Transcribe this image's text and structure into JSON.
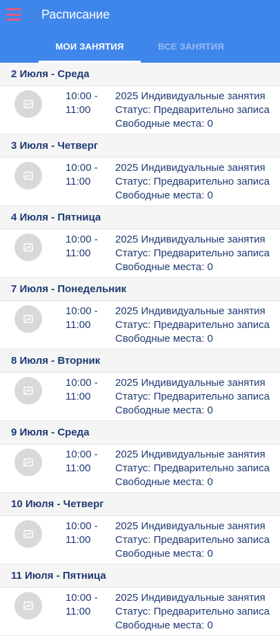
{
  "header": {
    "title": "Расписание",
    "menu_icon": "hamburger-menu-icon",
    "tabs": [
      {
        "label": "МОИ ЗАНЯТИЯ",
        "active": true
      },
      {
        "label": "ВСЕ ЗАНЯТИЯ",
        "active": false
      }
    ],
    "colors": {
      "bar": "#3f86ea",
      "menu_icon": "#e05a82",
      "text": "#1f3a73"
    }
  },
  "days": [
    {
      "date": "2 Июля - Среда",
      "session": {
        "start": "10:00 -",
        "end": "11:00",
        "name": "2025 Индивидуальные занятия",
        "status": "Статус: Предварительно записан",
        "seats": "Свободные места: 0",
        "thumb_icon": "image-placeholder-icon"
      }
    },
    {
      "date": "3 Июля - Четверг",
      "session": {
        "start": "10:00 -",
        "end": "11:00",
        "name": "2025 Индивидуальные занятия",
        "status": "Статус: Предварительно записан",
        "seats": "Свободные места: 0",
        "thumb_icon": "image-placeholder-icon"
      }
    },
    {
      "date": "4 Июля - Пятница",
      "session": {
        "start": "10:00 -",
        "end": "11:00",
        "name": "2025 Индивидуальные занятия",
        "status": "Статус: Предварительно записан",
        "seats": "Свободные места: 0",
        "thumb_icon": "image-placeholder-icon"
      }
    },
    {
      "date": "7 Июля - Понедельник",
      "session": {
        "start": "10:00 -",
        "end": "11:00",
        "name": "2025 Индивидуальные занятия",
        "status": "Статус: Предварительно записан",
        "seats": "Свободные места: 0",
        "thumb_icon": "image-placeholder-icon"
      }
    },
    {
      "date": "8 Июля - Вторник",
      "session": {
        "start": "10:00 -",
        "end": "11:00",
        "name": "2025 Индивидуальные занятия",
        "status": "Статус: Предварительно записан",
        "seats": "Свободные места: 0",
        "thumb_icon": "image-placeholder-icon"
      }
    },
    {
      "date": "9 Июля - Среда",
      "session": {
        "start": "10:00 -",
        "end": "11:00",
        "name": "2025 Индивидуальные занятия",
        "status": "Статус: Предварительно записан",
        "seats": "Свободные места: 0",
        "thumb_icon": "image-placeholder-icon"
      }
    },
    {
      "date": "10 Июля - Четверг",
      "session": {
        "start": "10:00 -",
        "end": "11:00",
        "name": "2025 Индивидуальные занятия",
        "status": "Статус: Предварительно записан",
        "seats": "Свободные места: 0",
        "thumb_icon": "image-placeholder-icon"
      }
    },
    {
      "date": "11 Июля - Пятница",
      "session": {
        "start": "10:00 -",
        "end": "11:00",
        "name": "2025 Индивидуальные занятия",
        "status": "Статус: Предварительно записан",
        "seats": "Свободные места: 0",
        "thumb_icon": "image-placeholder-icon"
      }
    }
  ]
}
